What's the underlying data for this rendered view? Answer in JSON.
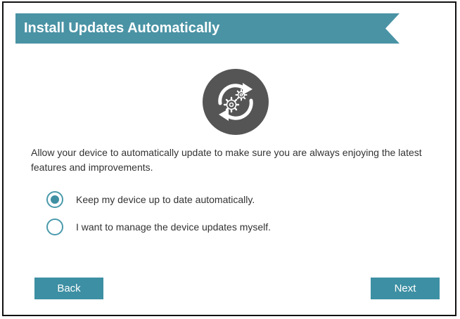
{
  "header": {
    "title": "Install Updates Automatically"
  },
  "colors": {
    "accent": "#4a93a5",
    "icon_circle": "#555555",
    "text": "#333333"
  },
  "icon": "auto-update-gears-icon",
  "description": "Allow your device to automatically update to make sure you are always enjoying the latest features and improvements.",
  "options": [
    {
      "label": "Keep my device up to date automatically.",
      "checked": true
    },
    {
      "label": "I want to manage the device updates myself.",
      "checked": false
    }
  ],
  "buttons": {
    "back_label": "Back",
    "next_label": "Next"
  }
}
